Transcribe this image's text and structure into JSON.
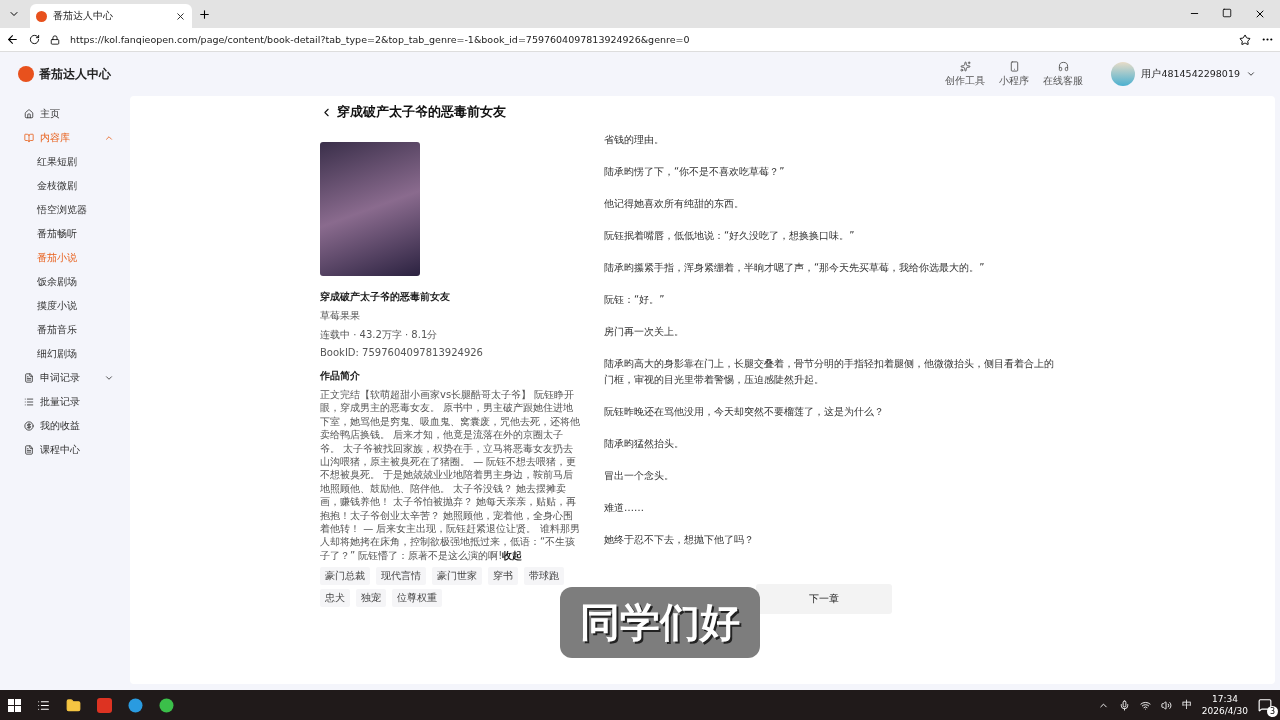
{
  "browser": {
    "tab_title": "番茄达人中心",
    "url": "https://kol.fanqieopen.com/page/content/book-detail?tab_type=2&top_tab_genre=-1&book_id=7597604097813924926&genre=0"
  },
  "header": {
    "logo": "番茄达人中心",
    "tools": [
      {
        "label": "创作工具",
        "kind": "sparkle"
      },
      {
        "label": "小程序",
        "kind": "phone"
      },
      {
        "label": "在线客服",
        "kind": "headset"
      }
    ],
    "user": "用户4814542298019"
  },
  "sidebar": {
    "items": [
      {
        "label": "主页",
        "kind": "home",
        "selected": false
      },
      {
        "label": "内容库",
        "kind": "book",
        "selected": true,
        "expanded": true,
        "children": [
          {
            "label": "红果短剧",
            "selected": false
          },
          {
            "label": "金枝微剧",
            "selected": false
          },
          {
            "label": "悟空浏览器",
            "selected": false
          },
          {
            "label": "番茄畅听",
            "selected": false
          },
          {
            "label": "番茄小说",
            "selected": true
          },
          {
            "label": "饭余剧场",
            "selected": false
          },
          {
            "label": "摸度小说",
            "selected": false
          },
          {
            "label": "番茄音乐",
            "selected": false
          },
          {
            "label": "细幻剧场",
            "selected": false
          }
        ]
      },
      {
        "label": "申词记录",
        "kind": "doc",
        "selected": false,
        "expanded": false
      },
      {
        "label": "批量记录",
        "kind": "list",
        "selected": false
      },
      {
        "label": "我的收益",
        "kind": "coin",
        "selected": false
      },
      {
        "label": "课程中心",
        "kind": "doc",
        "selected": false
      }
    ]
  },
  "book": {
    "title": "穿成破产太子爷的恶毒前女友",
    "name": "穿成破产太子爷的恶毒前女友",
    "author": "草莓果果",
    "meta": "连载中 · 43.2万字 · 8.1分",
    "book_id": "BookID: 7597604097813924926",
    "intro_heading": "作品简介",
    "intro": "正文完结【软萌超甜小画家vs长腿酷哥太子爷】 阮钰睁开眼，穿成男主的恶毒女友。 原书中，男主破产跟她住进地下室，她骂他是穷鬼、吸血鬼、窝囊废，咒他去死，还将他卖给鸭店换钱。 后来才知，他竟是流落在外的京圈太子爷。 太子爷被找回家族，权势在手，立马将恶毒女友扔去山沟喂猪，原主被臭死在了猪圈。 — 阮钰不想去喂猪，更不想被臭死。 于是她兢兢业业地陪着男主身边，鞍前马后地照顾他、鼓励他、陪伴他。 太子爷没钱？ 她去摆摊卖画，赚钱养他！ 太子爷怕被抛弃？ 她每天亲亲，贴贴，再抱抱！太子爷创业太辛苦？ 她照顾他，宠着他，全身心围着他转！ — 后来女主出现，阮钰赶紧退位让贤。 谁料那男人却将她拷在床角，控制欲极强地抵过来，低语：“不生孩子了？” 阮钰懵了：原著不是这么演的啊!",
    "collapse_link": "收起",
    "tags": [
      "豪门总裁",
      "现代言情",
      "豪门世家",
      "穿书",
      "带球跑",
      "忠犬",
      "独宠",
      "位尊权重"
    ]
  },
  "chapter": {
    "paragraphs": [
      "省钱的理由。",
      "陆承昀愣了下，“你不是不喜欢吃草莓？”",
      "他记得她喜欢所有纯甜的东西。",
      "阮钰抿着嘴唇，低低地说：“好久没吃了，想换换口味。”",
      "陆承昀攥紧手指，浑身紧绷着，半晌才嗯了声，“那今天先买草莓，我给你选最大的。”",
      "阮钰：“好。”",
      "房门再一次关上。",
      "陆承昀高大的身影靠在门上，长腿交叠着，骨节分明的手指轻扣着腿侧，他微微抬头，侧目看着合上的门框，审视的目光里带着警惕，压迫感陡然升起。",
      "阮钰昨晚还在骂他没用，今天却突然不要榴莲了，这是为什么？",
      "陆承昀猛然抬头。",
      "冒出一个念头。",
      "难道……",
      "她终于忍不下去，想抛下他了吗？"
    ],
    "next_button": "下一章"
  },
  "caption": "同学们好",
  "taskbar": {
    "ime": "中",
    "time": "17:34",
    "date": "2026/4/30",
    "notifications": "3"
  }
}
